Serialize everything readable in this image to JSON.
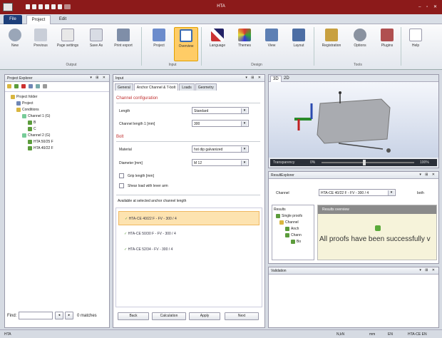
{
  "titlebar": {
    "title": "HTA",
    "window_controls": "– ▫ ✕"
  },
  "ribbon_tabs": {
    "file": "File",
    "project": "Project",
    "edit": "Edit"
  },
  "ribbon": {
    "buttons": [
      "New",
      "Previous",
      "Page settings",
      "Save As",
      "Print export",
      "Project",
      "Overview",
      "Language",
      "Themes",
      "View",
      "Layout",
      "Registration",
      "Options",
      "Plugins",
      "Help"
    ],
    "groups": [
      "Output",
      "Input",
      "Design",
      "Tools"
    ]
  },
  "explorer": {
    "title": "Project Explorer",
    "tree": [
      "Project folder",
      "Project",
      "Conditions",
      "Channel 1 (G)",
      "B",
      "C",
      "Channel 2 (G)",
      "HTA 50/25 F",
      "HTA 40/22 F"
    ],
    "find_label": "Find:",
    "matches": "0 matches"
  },
  "input": {
    "title": "Input",
    "tabs": [
      "General",
      "Anchor Channel & T-bolt",
      "Loads",
      "Geometry"
    ],
    "sec_channel": "Channel configuration",
    "length_label": "Length",
    "length_value": "Standard",
    "channel_length_label": "Channel length 1 [mm]",
    "channel_length_value": "300",
    "sec_bolt": "Bolt",
    "material_label": "Material",
    "material_value": "hot dip galvanized",
    "diameter_label": "Diameter [mm]",
    "diameter_value": "M 12",
    "grip_label": "Grip length [mm]",
    "shear_label": "Shear load with lever arm",
    "available_label": "Available at selected anchor channel length",
    "items": [
      "HTA-CE 40/22 F - FV - 300 / 4",
      "HTA-CE 50/30 F - FV - 300 / 4",
      "HTA-CE 52/34 - FV - 300 / 4"
    ],
    "buttons": [
      "Back",
      "Calculation",
      "Apply",
      "Next"
    ]
  },
  "view3d": {
    "tab1": "3D",
    "tab2": "2D",
    "slider_label": "Transparency",
    "pct_left": "0%",
    "pct_right": "100%"
  },
  "results": {
    "title": "ResultExplorer",
    "channel_label": "Channel",
    "channel_value": "HTA-CE 40/22 F - FV - 300 / 4",
    "unit": "both",
    "tree": [
      "Results",
      "Single proofs",
      "Channel",
      "Anch",
      "Chann",
      "Bo"
    ],
    "summary_header": "Results overview",
    "message": "All proofs have been successfully v"
  },
  "validation": {
    "title": "Validation"
  },
  "status": {
    "left": "HTA",
    "unit1": "N,kN",
    "unit2": "mm",
    "unit3": "EN",
    "product": "HTA-CE EN"
  },
  "colors": {
    "titlebar": "#8c1a1a",
    "accent": "#ffcc66",
    "success": "#5aaa3a"
  }
}
